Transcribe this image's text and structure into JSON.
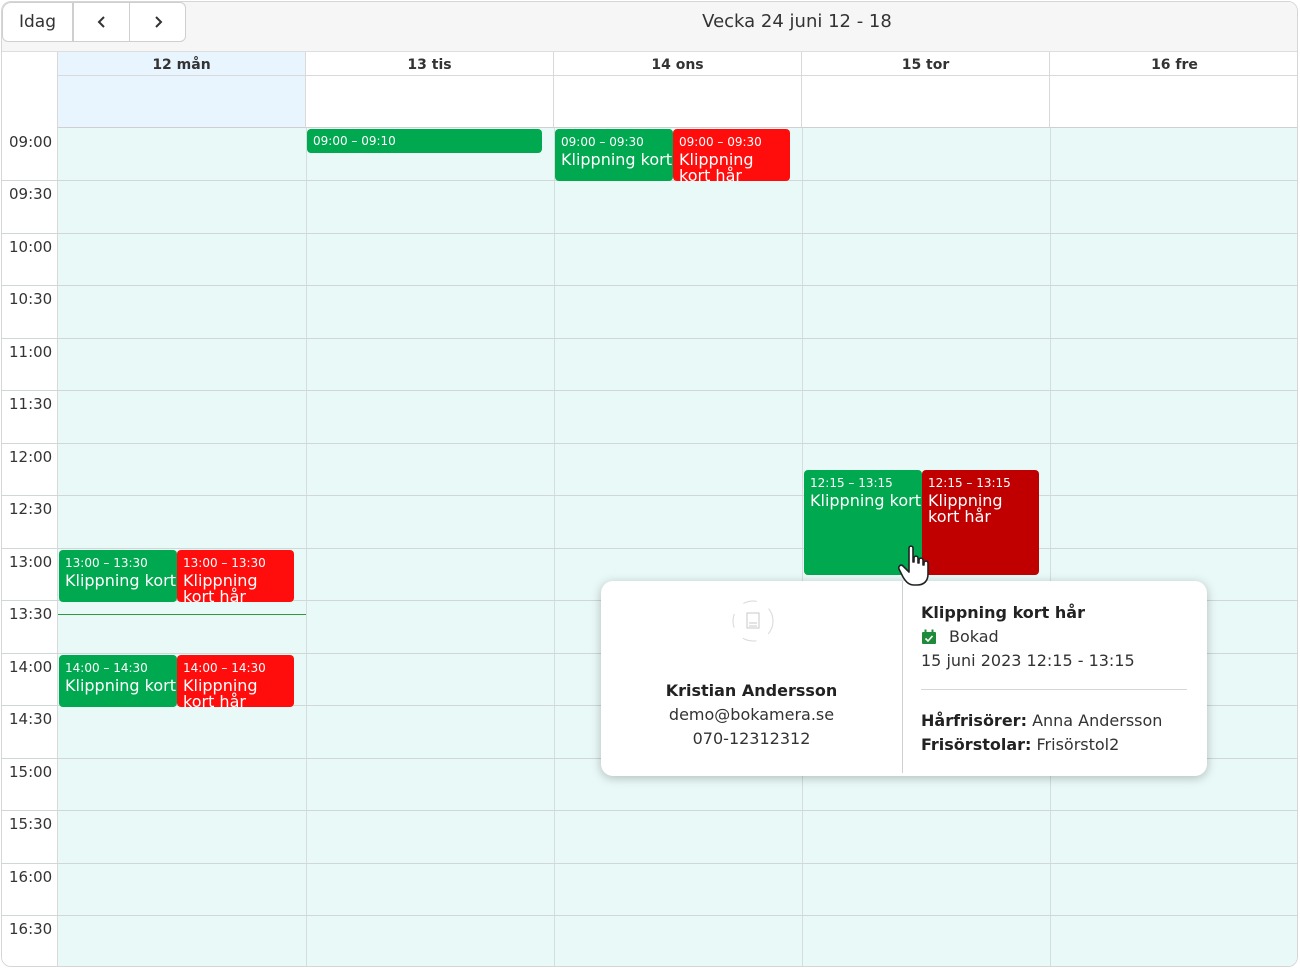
{
  "toolbar": {
    "today_label": "Idag",
    "prev_icon": "chevron-left-icon",
    "next_icon": "chevron-right-icon",
    "week_title": "Vecka 24 juni 12 - 18"
  },
  "days": [
    {
      "label": "12 mån",
      "today": true
    },
    {
      "label": "13 tis"
    },
    {
      "label": "14 ons"
    },
    {
      "label": "15 tor"
    },
    {
      "label": "16 fre"
    }
  ],
  "times": [
    "09:00",
    "09:30",
    "10:00",
    "10:30",
    "11:00",
    "11:30",
    "12:00",
    "12:30",
    "13:00",
    "13:30",
    "14:00",
    "14:30",
    "15:00",
    "15:30",
    "16:00",
    "16:30"
  ],
  "events": [
    {
      "day": "13 tis",
      "time": "09:00 – 09:10",
      "title": "",
      "color": "#00a84f"
    },
    {
      "day": "14 ons",
      "time": "09:00 – 09:30",
      "title": "Klippning kort",
      "color": "#00a84f"
    },
    {
      "day": "14 ons",
      "time": "09:00 – 09:30",
      "title": "Klippning kort hår",
      "color": "#ff0d0d"
    },
    {
      "day": "15 tor",
      "time": "12:15 – 13:15",
      "title": "Klippning kort",
      "color": "#00a84f"
    },
    {
      "day": "15 tor",
      "time": "12:15 – 13:15",
      "title": "Klippning kort hår",
      "color": "#c00000"
    },
    {
      "day": "12 mån",
      "time": "13:00 – 13:30",
      "title": "Klippning kort",
      "color": "#00a84f"
    },
    {
      "day": "12 mån",
      "time": "13:00 – 13:30",
      "title": "Klippning kort hår",
      "color": "#ff0d0d"
    },
    {
      "day": "12 mån",
      "time": "14:00 – 14:30",
      "title": "Klippning kort",
      "color": "#00a84f"
    },
    {
      "day": "12 mån",
      "time": "14:00 – 14:30",
      "title": "Klippning kort hår",
      "color": "#ff0d0d"
    }
  ],
  "popup": {
    "avatar_icon": "avatar-placeholder-icon",
    "customer_name": "Kristian Andersson",
    "email": "demo@bokamera.se",
    "phone": "070-12312312",
    "service_title": "Klippning kort hår",
    "status_icon": "calendar-check-icon",
    "status": "Bokad",
    "datetime": "15 juni 2023 12:15 - 13:15",
    "hairdresser_label": "Hårfrisörer:",
    "hairdresser_value": "Anna Andersson",
    "chair_label": "Frisörstolar:",
    "chair_value": "Frisörstol2"
  },
  "colors": {
    "accent_green": "#00a84f",
    "accent_red": "#ff0d0d",
    "accent_dark_red": "#c00000",
    "grid_bg": "#e9f9f7",
    "today_bg": "#e8f4fe",
    "now_line": "#2d9a3c"
  }
}
